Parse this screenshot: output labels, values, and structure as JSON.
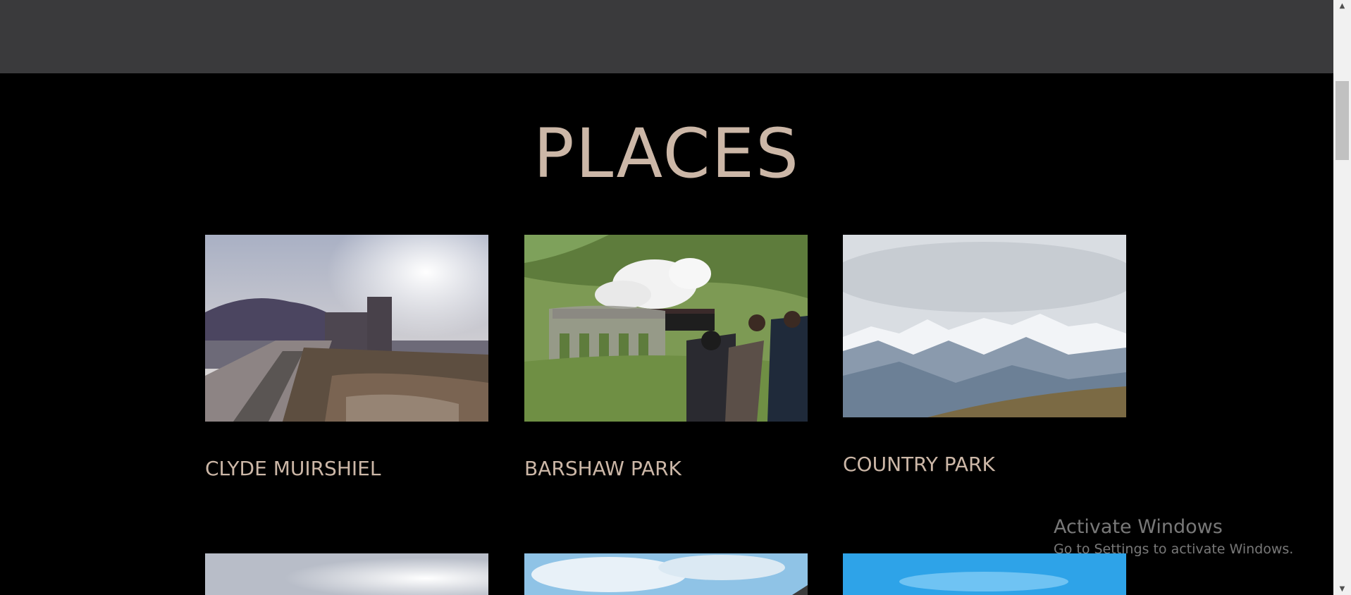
{
  "section": {
    "title": "PLACES"
  },
  "places": [
    {
      "title": "CLYDE MUIRSHIEL"
    },
    {
      "title": "BARSHAW PARK"
    },
    {
      "title": "COUNTRY PARK"
    }
  ],
  "watermark": {
    "title": "Activate Windows",
    "subtitle": "Go to Settings to activate Windows."
  },
  "scrollbar": {
    "up_icon": "chevron-up-icon",
    "down_icon": "chevron-down-icon"
  },
  "colors": {
    "header_bg": "#3a3a3c",
    "page_bg": "#000000",
    "accent_text": "#ccb7a7"
  }
}
